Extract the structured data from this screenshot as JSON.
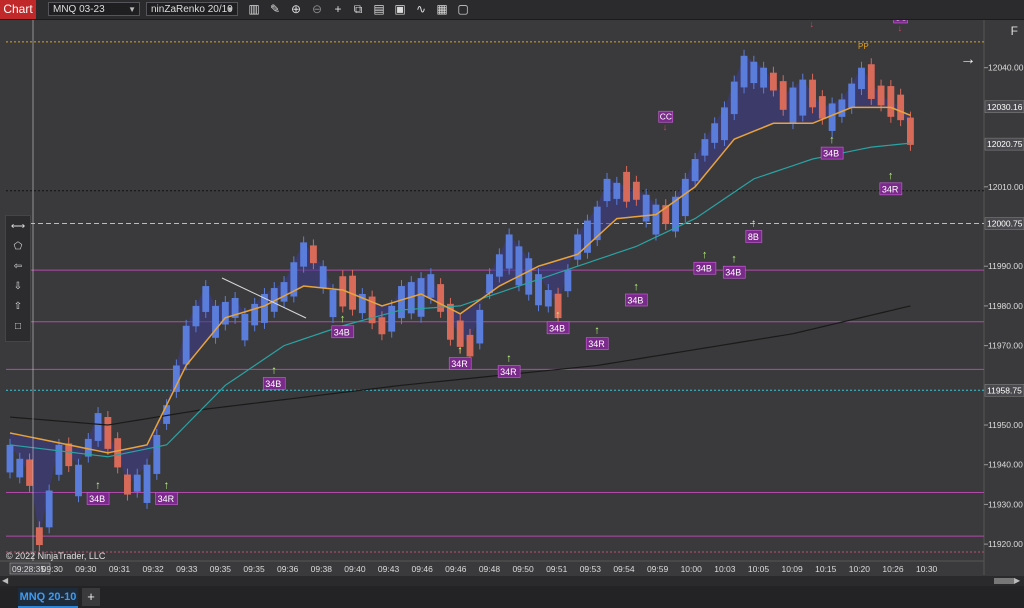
{
  "toolbar": {
    "chart_tab": "Chart",
    "instrument": "MNQ 03-23",
    "bar_type": "ninZaRenko 20/10",
    "icons": [
      "bars-icon",
      "pencil-icon",
      "zoom-in-icon",
      "zoom-out-icon",
      "crosshair-icon",
      "properties-icon",
      "data-box-icon",
      "strategies-icon",
      "indicators-icon",
      "templates-icon"
    ]
  },
  "panel_label": "F",
  "copyright": "© 2022 NinjaTrader, LLC",
  "bottom": {
    "instrument_tab": "MNQ 20-10",
    "add_tab": "+"
  },
  "left_tools": [
    "⟷",
    "⬠",
    "⇦",
    "⇩",
    "⇧",
    "□"
  ],
  "colors": {
    "background": "#3a3a3d",
    "up_bar": "#5a7ddc",
    "down_bar": "#d86a5a",
    "ema_fast": "#e8a33a",
    "ema_slow": "#2aa3a3",
    "sma_long": "#1a1a1a",
    "label_bg": "#7a2a8a",
    "signal_arrow": "#b6f07a",
    "pp_line": "#e0a020",
    "price_marker": "#ffffff"
  },
  "chart_data": {
    "type": "candlestick",
    "ylim": [
      11916,
      12050
    ],
    "y_ticks": [
      11920.0,
      11930.0,
      11940.0,
      11950.0,
      11970.0,
      11980.0,
      11990.0,
      12010.0,
      12040.0
    ],
    "x_labels": [
      "09:28:35",
      "09:30",
      "09:30",
      "09:31",
      "09:32",
      "09:33",
      "09:35",
      "09:35",
      "09:36",
      "09:38",
      "09:40",
      "09:43",
      "09:46",
      "09:46",
      "09:48",
      "09:50",
      "09:51",
      "09:53",
      "09:54",
      "09:59",
      "10:00",
      "10:03",
      "10:05",
      "10:09",
      "10:15",
      "10:20",
      "10:26",
      "10:30"
    ],
    "price_markers": [
      {
        "value": 12030.16,
        "label": "12030.16"
      },
      {
        "value": 12020.75,
        "label": "12020.75"
      },
      {
        "value": 12000.75,
        "label": "12000.75"
      },
      {
        "value": 11958.75,
        "label": "11958.75"
      }
    ],
    "close_path": [
      [
        0,
        11945
      ],
      [
        2,
        11938
      ],
      [
        3,
        11922
      ],
      [
        5,
        11945
      ],
      [
        7,
        11940
      ],
      [
        9,
        11953
      ],
      [
        11,
        11943
      ],
      [
        12,
        11935
      ],
      [
        14,
        11940
      ],
      [
        16,
        11955
      ],
      [
        18,
        11975
      ],
      [
        20,
        11985
      ],
      [
        21,
        11980
      ],
      [
        23,
        11982
      ],
      [
        24,
        11978
      ],
      [
        26,
        11983
      ],
      [
        28,
        11986
      ],
      [
        30,
        11996
      ],
      [
        32,
        11990
      ],
      [
        33,
        11984
      ],
      [
        36,
        11983
      ],
      [
        38,
        11975
      ],
      [
        40,
        11985
      ],
      [
        43,
        11988
      ],
      [
        45,
        11976
      ],
      [
        47,
        11970
      ],
      [
        49,
        11988
      ],
      [
        51,
        11998
      ],
      [
        53,
        11992
      ],
      [
        56,
        11980
      ],
      [
        58,
        11998
      ],
      [
        60,
        12005
      ],
      [
        61,
        12012
      ],
      [
        63,
        12010
      ],
      [
        65,
        12008
      ],
      [
        67,
        12003
      ],
      [
        69,
        12012
      ],
      [
        71,
        12022
      ],
      [
        73,
        12030
      ],
      [
        75,
        12043
      ],
      [
        77,
        12040
      ],
      [
        79,
        12033
      ],
      [
        81,
        12037
      ],
      [
        83,
        12030
      ],
      [
        85,
        12032
      ],
      [
        87,
        12040
      ],
      [
        89,
        12033
      ],
      [
        91,
        12030
      ],
      [
        92,
        12024
      ]
    ],
    "bar_count": 94,
    "ema_fast": [
      [
        0,
        11948
      ],
      [
        6,
        11945
      ],
      [
        10,
        11943
      ],
      [
        14,
        11945
      ],
      [
        18,
        11965
      ],
      [
        22,
        11977
      ],
      [
        26,
        11980
      ],
      [
        30,
        11985
      ],
      [
        34,
        11984
      ],
      [
        38,
        11980
      ],
      [
        42,
        11983
      ],
      [
        46,
        11978
      ],
      [
        50,
        11985
      ],
      [
        54,
        11990
      ],
      [
        58,
        11993
      ],
      [
        62,
        12002
      ],
      [
        66,
        12003
      ],
      [
        70,
        12010
      ],
      [
        74,
        12022
      ],
      [
        78,
        12026
      ],
      [
        82,
        12026
      ],
      [
        86,
        12030
      ],
      [
        90,
        12030
      ],
      [
        92,
        12028
      ]
    ],
    "ema_slow": [
      [
        0,
        11945
      ],
      [
        10,
        11942
      ],
      [
        16,
        11945
      ],
      [
        22,
        11960
      ],
      [
        28,
        11970
      ],
      [
        34,
        11975
      ],
      [
        40,
        11979
      ],
      [
        46,
        11980
      ],
      [
        52,
        11985
      ],
      [
        58,
        11990
      ],
      [
        64,
        11995
      ],
      [
        70,
        12002
      ],
      [
        76,
        12012
      ],
      [
        82,
        12017
      ],
      [
        88,
        12020
      ],
      [
        92,
        12021
      ]
    ],
    "sma_long": [
      [
        0,
        11952
      ],
      [
        10,
        11950
      ],
      [
        20,
        11954
      ],
      [
        40,
        11960
      ],
      [
        60,
        11965
      ],
      [
        80,
        11973
      ],
      [
        92,
        11980
      ]
    ],
    "horizontal_lines": [
      {
        "value": 12046.5,
        "color": "#e0a020",
        "style": "dotted",
        "label": "PP"
      },
      {
        "value": 12009.0,
        "color": "#111111",
        "style": "dotted",
        "label": ""
      },
      {
        "value": 12000.75,
        "color": "#bbbbbb",
        "style": "dashed",
        "label": ""
      },
      {
        "value": 11989.0,
        "color": "#b04aa8",
        "style": "solid",
        "label": ""
      },
      {
        "value": 11976.0,
        "color": "#b04aa8",
        "style": "solid",
        "label": ""
      },
      {
        "value": 11964.0,
        "color": "#b04aa8",
        "style": "solid",
        "label": ""
      },
      {
        "value": 11958.75,
        "color": "#38c8d8",
        "style": "dotted",
        "label": ""
      },
      {
        "value": 11933.0,
        "color": "#b04aa8",
        "style": "solid",
        "label": ""
      },
      {
        "value": 11922.0,
        "color": "#b04aa8",
        "style": "solid",
        "label": ""
      },
      {
        "value": 11918.0,
        "color": "#c0506a",
        "style": "dotted",
        "label": ""
      }
    ],
    "signals": [
      {
        "bar": 9,
        "price": 11933,
        "label": "34B",
        "dir": "up"
      },
      {
        "bar": 16,
        "price": 11933,
        "label": "34R",
        "dir": "up"
      },
      {
        "bar": 27,
        "price": 11962,
        "label": "34B",
        "dir": "up"
      },
      {
        "bar": 34,
        "price": 11975,
        "label": "34B",
        "dir": "up"
      },
      {
        "bar": 46,
        "price": 11967,
        "label": "34R",
        "dir": "up"
      },
      {
        "bar": 51,
        "price": 11965,
        "label": "34R",
        "dir": "up"
      },
      {
        "bar": 56,
        "price": 11976,
        "label": "34B",
        "dir": "up"
      },
      {
        "bar": 60,
        "price": 11972,
        "label": "34R",
        "dir": "up"
      },
      {
        "bar": 64,
        "price": 11983,
        "label": "34B",
        "dir": "up"
      },
      {
        "bar": 71,
        "price": 11991,
        "label": "34B",
        "dir": "up"
      },
      {
        "bar": 74,
        "price": 11990,
        "label": "34B",
        "dir": "up"
      },
      {
        "bar": 76,
        "price": 11999,
        "label": "8B",
        "dir": "up"
      },
      {
        "bar": 84,
        "price": 12020,
        "label": "34B",
        "dir": "up"
      },
      {
        "bar": 90,
        "price": 12011,
        "label": "34R",
        "dir": "up"
      },
      {
        "bar": 67,
        "price": 12024,
        "label": "CC",
        "dir": "down"
      },
      {
        "bar": 82,
        "price": 12050,
        "label": "CC",
        "dir": "down"
      },
      {
        "bar": 91,
        "price": 12049,
        "label": "CC",
        "dir": "down"
      }
    ]
  }
}
